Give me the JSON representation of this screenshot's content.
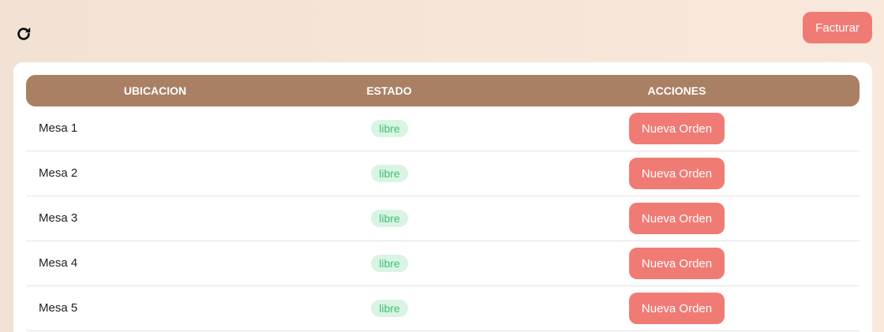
{
  "toolbar": {
    "refresh_icon": "refresh-icon",
    "facturar_label": "Facturar"
  },
  "table": {
    "columns": [
      "UBICACION",
      "ESTADO",
      "ACCIONES"
    ],
    "rows": [
      {
        "ubicacion": "Mesa 1",
        "estado": "libre",
        "accion": "Nueva Orden"
      },
      {
        "ubicacion": "Mesa 2",
        "estado": "libre",
        "accion": "Nueva Orden"
      },
      {
        "ubicacion": "Mesa 3",
        "estado": "libre",
        "accion": "Nueva Orden"
      },
      {
        "ubicacion": "Mesa 4",
        "estado": "libre",
        "accion": "Nueva Orden"
      },
      {
        "ubicacion": "Mesa 5",
        "estado": "libre",
        "accion": "Nueva Orden"
      }
    ]
  },
  "colors": {
    "accent": "#f07b74",
    "header_bg": "#a98064",
    "status_bg": "#d9f4e3",
    "status_text": "#3cbf73"
  }
}
